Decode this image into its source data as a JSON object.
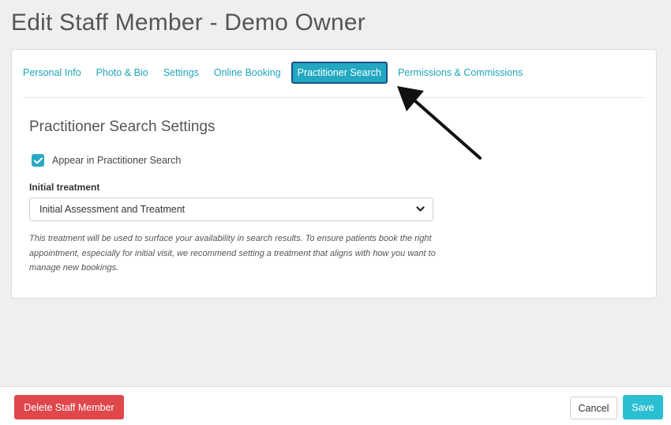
{
  "page": {
    "title": "Edit Staff Member - Demo Owner"
  },
  "tabs": [
    {
      "label": "Personal Info",
      "active": false
    },
    {
      "label": "Photo & Bio",
      "active": false
    },
    {
      "label": "Settings",
      "active": false
    },
    {
      "label": "Online Booking",
      "active": false
    },
    {
      "label": "Practitioner Search",
      "active": true
    },
    {
      "label": "Permissions & Commissions",
      "active": false
    }
  ],
  "section": {
    "title": "Practitioner Search Settings",
    "checkbox_label": "Appear in Practitioner Search",
    "checkbox_checked": true,
    "field_label": "Initial treatment",
    "select_value": "Initial Assessment and Treatment",
    "help_text": "This treatment will be used to surface your availability in search results. To ensure patients book the right appointment, especially for initial visit, we recommend setting a treatment that aligns with how you want to manage new bookings."
  },
  "footer": {
    "delete_label": "Delete Staff Member",
    "cancel_label": "Cancel",
    "save_label": "Save"
  },
  "icons": {
    "checkbox": "check-icon",
    "select": "chevron-down-icon",
    "annotation": "arrow-icon"
  },
  "colors": {
    "accent": "#23a8c2",
    "danger": "#e0474b",
    "save": "#2bbfd3"
  }
}
